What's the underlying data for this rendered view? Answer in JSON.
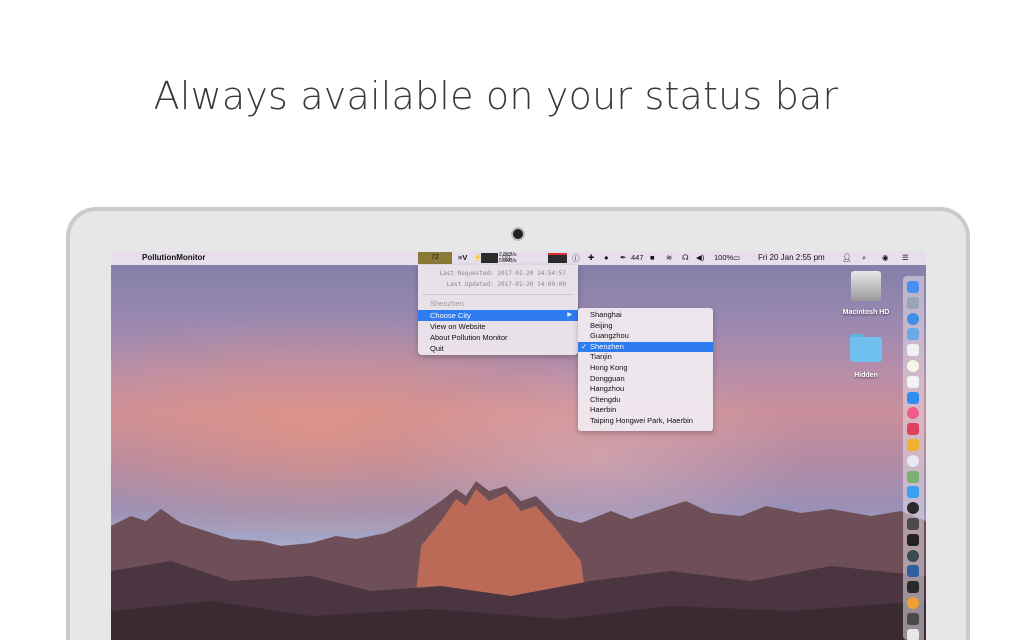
{
  "headline": "Always available on your status bar",
  "menubar": {
    "apple": "",
    "app_name": "PollutionMonitor",
    "aqi_value": "72",
    "net_up": "2.8KB/s",
    "net_down": "5.5KB/s",
    "count": "447",
    "battery": "100%",
    "datetime": "Fri 20 Jan  2:55 pm"
  },
  "menu": {
    "last_requested": "Last Requested: 2017-01-20 14:54:57",
    "last_updated": "Last Updated: 2017-01-20 14:00:00",
    "current_city": "Shenzhen",
    "choose_city": "Choose City",
    "view_website": "View on Website",
    "about": "About Pollution Monitor",
    "quit": "Quit"
  },
  "cities": [
    "Shanghai",
    "Beijing",
    "Guangzhou",
    "Shenzhen",
    "Tianjin",
    "Hong Kong",
    "Dongguan",
    "Hangzhou",
    "Chengdu",
    "Haerbin",
    "Taiping Hongwei Park, Haerbin"
  ],
  "selected_city": "Shenzhen",
  "check": "✓",
  "desktop": {
    "disk_label": "Macintosh HD",
    "folder_label": "Hidden"
  },
  "dock_icons": [
    "finder-icon",
    "launchpad-icon",
    "safari-icon",
    "mail-icon",
    "calendar-icon",
    "notes-icon",
    "reminders-icon",
    "app-store-icon",
    "itunes-icon",
    "pocket-icon",
    "photos-icon",
    "preview-icon",
    "maps-icon",
    "messages-icon",
    "dark-app-icon",
    "camera-icon",
    "terminal-icon",
    "activity-icon",
    "network-icon",
    "tes-icon",
    "butterfly-icon",
    "chrome-icon",
    "tickets-icon",
    "blue-app-icon"
  ],
  "colors": {
    "highlight": "#2f7bf0",
    "aqi_badge": "#8a7a36"
  }
}
